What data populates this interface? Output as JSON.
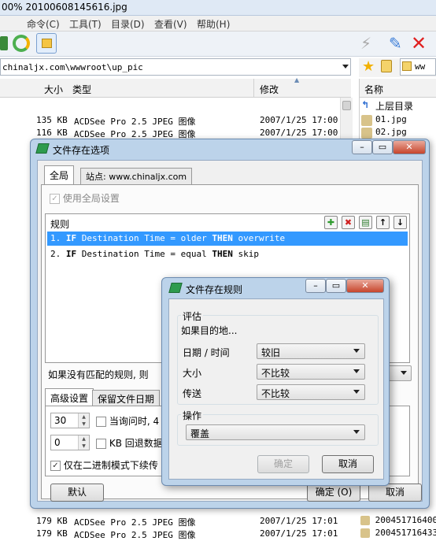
{
  "window": {
    "title": "00% 20100608145616.jpg"
  },
  "menu": [
    "命令(C)",
    "工具(T)",
    "目录(D)",
    "查看(V)",
    "帮助(H)"
  ],
  "path": {
    "value": "chinaljx.com\\wwwroot\\up_pic",
    "right": "ww"
  },
  "columns": {
    "size": "大小",
    "type": "类型",
    "modified": "修改",
    "name": "名称"
  },
  "files_top": [
    {
      "size": "135 KB",
      "type": "ACDSee Pro 2.5 JPEG 图像",
      "modified": "2007/1/25 17:00"
    },
    {
      "size": "116 KB",
      "type": "ACDSee Pro 2.5 JPEG 图像",
      "modified": "2007/1/25 17:00"
    }
  ],
  "files_bottom": [
    {
      "size": "179 KB",
      "type": "ACDSee Pro 2.5 JPEG 图像",
      "modified": "2007/1/25 17:01"
    },
    {
      "size": "179 KB",
      "type": "ACDSee Pro 2.5 JPEG 图像",
      "modified": "2007/1/25 17:01"
    }
  ],
  "right_pane": {
    "up": "上层目录",
    "items": [
      "01.jpg",
      "02.jpg"
    ],
    "bottom_items": [
      "200451716400",
      "200451716433"
    ]
  },
  "dialog1": {
    "title": "文件存在选项",
    "tab_global": "全局",
    "tab_site": "站点: www.chinaljx.com",
    "use_global": "使用全局设置",
    "rules_label": "规则",
    "rules": [
      {
        "num": "1.",
        "kw1": "IF",
        "cond": "Destination Time =",
        "val": "older",
        "kw2": "THEN",
        "act": "overwrite"
      },
      {
        "num": "2.",
        "kw1": "IF",
        "cond": "Destination Time =",
        "val": "equal",
        "kw2": "THEN",
        "act": "skip"
      }
    ],
    "no_match": "如果没有匹配的规则, 则",
    "tab_adv": "高级设置",
    "tab_keep_date": "保留文件日期",
    "spin1": "30",
    "spin2": "0",
    "chk_ask": "当询问时, 4",
    "chk_kb": "KB 回退数据",
    "chk_binary": "仅在二进制模式下续传",
    "default_btn": "默认",
    "ok_btn": "确定 (O)",
    "cancel_btn": "取消"
  },
  "dialog2": {
    "title": "文件存在规则",
    "eval_group": "评估",
    "if_dest": "如果目的地...",
    "date_label": "日期 / 时间",
    "date_val": "较旧",
    "size_label": "大小",
    "size_val": "不比较",
    "transfer_label": "传送",
    "transfer_val": "不比较",
    "action_group": "操作",
    "action_val": "覆盖",
    "ok_btn": "确定",
    "cancel_btn": "取消"
  },
  "colors": {
    "selection": "#3399ff",
    "dialog_frame": "#bcd3ea"
  }
}
